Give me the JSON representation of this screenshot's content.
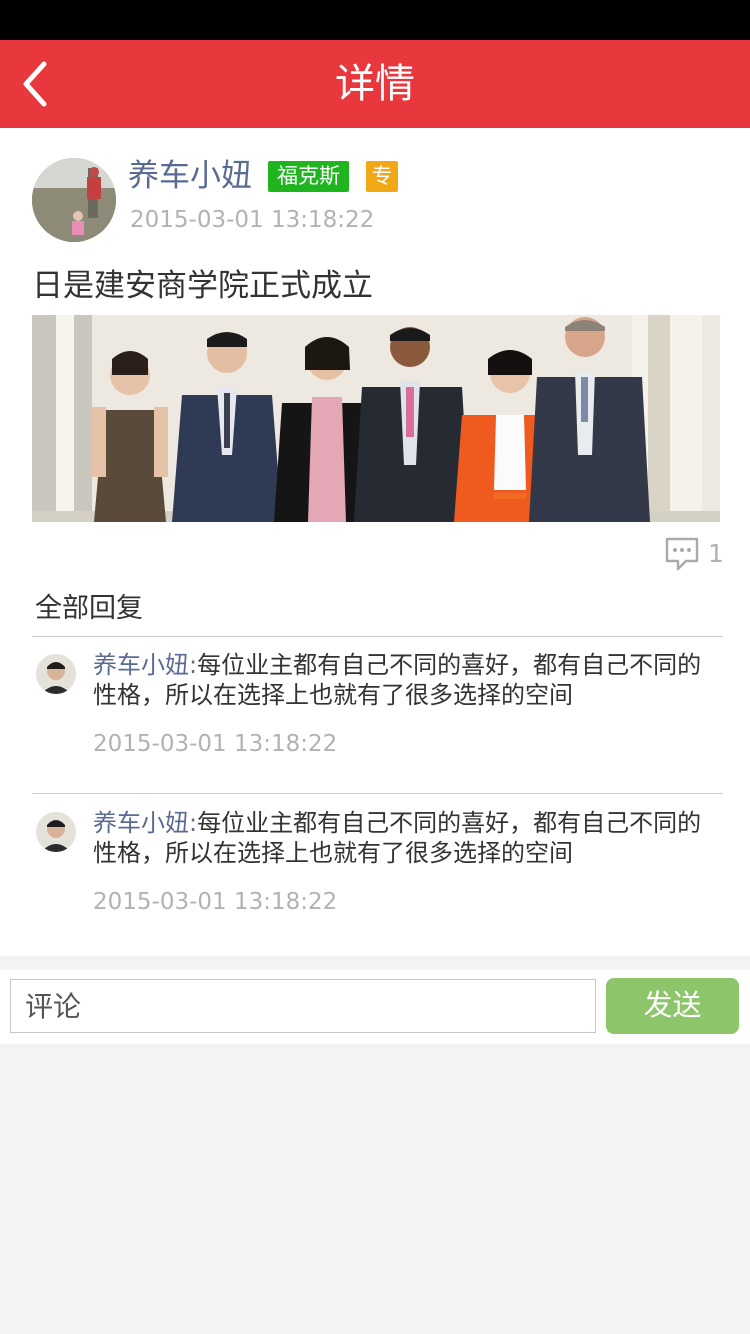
{
  "header": {
    "title": "详情",
    "back_icon": "chevron-left-icon",
    "bg_color": "#e8383d"
  },
  "post": {
    "author": "养车小妞",
    "brand_badge": "福克斯",
    "pro_badge": "专",
    "time": "2015-03-01 13:18:22",
    "text": "日是建安商学院正式成立",
    "comment_icon": "comment-bubble-icon",
    "comment_count": "1"
  },
  "replies_title": "全部回复",
  "replies": [
    {
      "name": "养车小妞:",
      "text": "每位业主都有自己不同的喜好，都有自己不同的性格，所以在选择上也就有了很多选择的空间",
      "time": "2015-03-01 13:18:22"
    },
    {
      "name": "养车小妞:",
      "text": "每位业主都有自己不同的喜好，都有自己不同的性格，所以在选择上也就有了很多选择的空间",
      "time": "2015-03-01 13:18:22"
    }
  ],
  "comment_bar": {
    "placeholder": "评论",
    "send_label": "发送",
    "send_color": "#8cc56a"
  }
}
